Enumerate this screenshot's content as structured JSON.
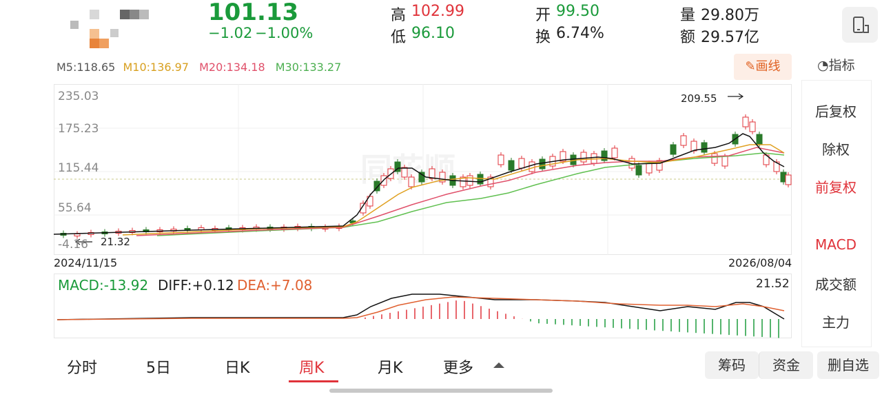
{
  "quote": {
    "price": "101.13",
    "change": "−1.02",
    "change_pct": "−1.00%",
    "high_label": "高",
    "high": "102.99",
    "low_label": "低",
    "low": "96.10",
    "open_label": "开",
    "open": "99.50",
    "turnover_label": "换",
    "turnover": "6.74%",
    "volume_label": "量",
    "volume": "29.80万",
    "amount_label": "额",
    "amount": "29.57亿"
  },
  "ma": {
    "m5": "M5:118.65",
    "m10": "M10:136.97",
    "m20": "M20:134.18",
    "m30": "M30:133.27"
  },
  "draw_button": "画线",
  "indicator_button": "指标",
  "axis": {
    "y_ticks": [
      "235.03",
      "175.23",
      "115.44",
      "55.64",
      "-4.16"
    ],
    "start_date": "2024/11/15",
    "end_date": "2026/08/04",
    "max_annot": "209.55",
    "min_annot": "21.32"
  },
  "macd": {
    "macd": "MACD:-13.92",
    "diff": "DIFF:+0.12",
    "dea": "DEA:+7.08",
    "top": "21.52"
  },
  "sidebar": {
    "items": [
      "后复权",
      "除权",
      "前复权",
      "MACD",
      "成交额",
      "主力"
    ]
  },
  "tabs": [
    "分时",
    "5日",
    "日K",
    "周K",
    "月K",
    "更多"
  ],
  "active_tab": "周K",
  "bottom_buttons": {
    "chips": "筹码",
    "funds": "资金",
    "remove": "删自选"
  },
  "colors": {
    "up": "#e0333a",
    "down": "#1a9a3a",
    "ma5": "#111111",
    "ma10": "#e0a020",
    "ma20": "#e0506a",
    "ma30": "#60c050"
  }
}
